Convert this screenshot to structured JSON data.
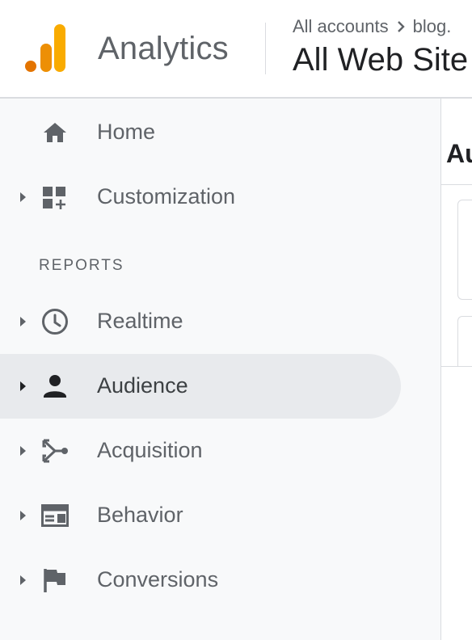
{
  "header": {
    "product_name": "Analytics",
    "breadcrumb": {
      "account": "All accounts",
      "property": "blog."
    },
    "view_name": "All Web Site"
  },
  "sidebar": {
    "items_top": [
      {
        "label": "Home",
        "icon": "home-icon"
      },
      {
        "label": "Customization",
        "icon": "dashboard-customization-icon"
      }
    ],
    "section_label": "REPORTS",
    "reports": [
      {
        "label": "Realtime",
        "icon": "clock-icon"
      },
      {
        "label": "Audience",
        "icon": "person-icon",
        "active": true
      },
      {
        "label": "Acquisition",
        "icon": "merge-arrows-icon"
      },
      {
        "label": "Behavior",
        "icon": "web-layout-icon"
      },
      {
        "label": "Conversions",
        "icon": "flag-icon"
      }
    ]
  },
  "main": {
    "title": "Au"
  },
  "colors": {
    "logo_orange_light": "#F9AB00",
    "logo_orange_dark": "#E37400",
    "sidebar_bg": "#f8f9fa",
    "active_bg": "#e8eaed",
    "icon_gray": "#5f6368",
    "active_icon": "#202124"
  }
}
